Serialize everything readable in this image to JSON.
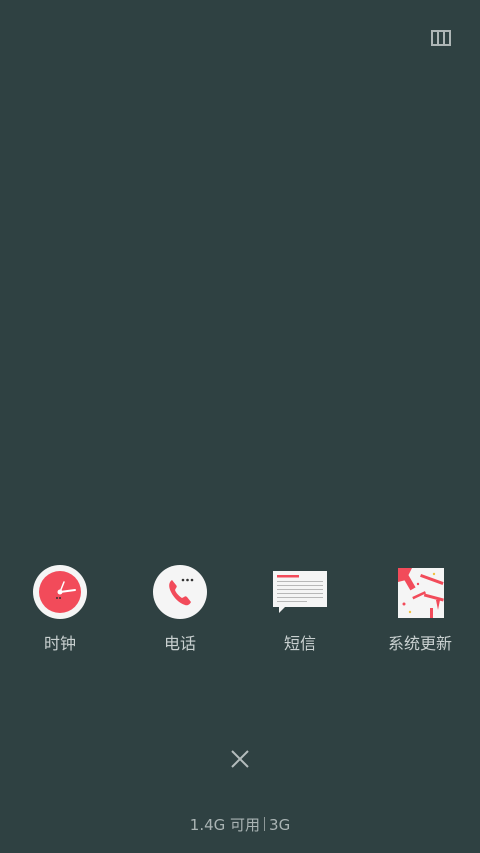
{
  "icons": {
    "layout_toggle": "recent-layout-icon",
    "close": "close-icon"
  },
  "colors": {
    "background": "#2f4142",
    "accent": "#f24b5a",
    "label": "#c9d0d0"
  },
  "apps": [
    {
      "label": "时钟",
      "icon": "clock-icon"
    },
    {
      "label": "电话",
      "icon": "phone-icon"
    },
    {
      "label": "短信",
      "icon": "message-icon"
    },
    {
      "label": "系统更新",
      "icon": "system-update-icon"
    }
  ],
  "footer": {
    "memory_available": "1.4G 可用",
    "network": "3G"
  }
}
